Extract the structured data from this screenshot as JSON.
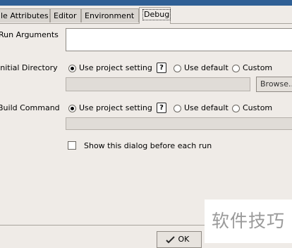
{
  "tabs": [
    {
      "label": "le Attributes",
      "active": false
    },
    {
      "label": "Editor",
      "active": false
    },
    {
      "label": "Environment",
      "active": false
    },
    {
      "label": "Debug",
      "active": true
    }
  ],
  "run_arguments": {
    "label": "Run Arguments",
    "value": ""
  },
  "initial_directory": {
    "label": "Initial Directory",
    "options": [
      "Use project setting",
      "Use default",
      "Custom"
    ],
    "selected": "Use project setting",
    "path_value": "",
    "browse_label": "Browse..."
  },
  "build_command": {
    "label": "Build Command",
    "options": [
      "Use project setting",
      "Use default",
      "Custom"
    ],
    "selected": "Use project setting",
    "command_value": ""
  },
  "show_dialog": {
    "label": "Show this dialog before each run",
    "checked": false
  },
  "footer": {
    "ok_label": "OK"
  },
  "watermark": {
    "text": "软件技巧"
  },
  "colors": {
    "background": "#efebe7",
    "titlebar": "#2f5f95"
  }
}
